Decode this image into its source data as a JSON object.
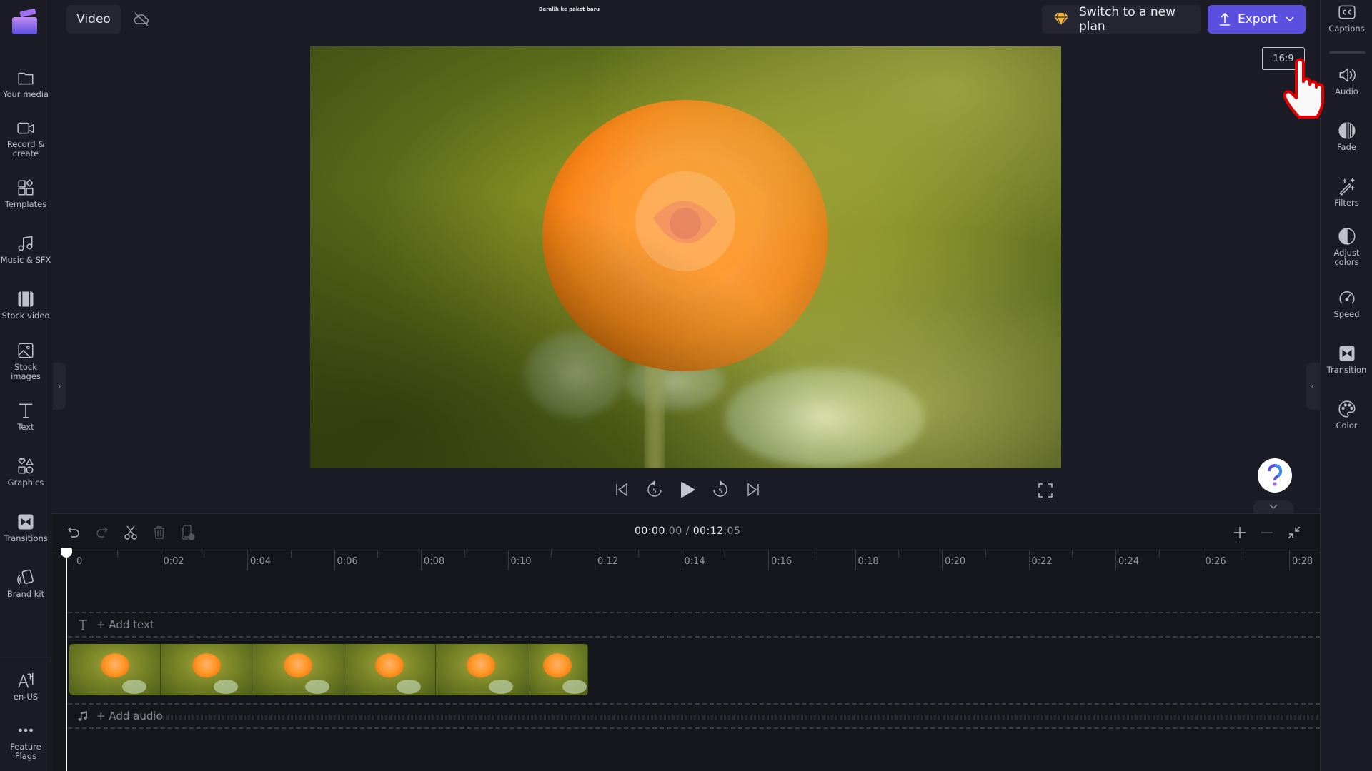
{
  "header": {
    "project_tab": "Video",
    "cloud_status_icon": "cloud-off-icon",
    "center_text": "Beralih ke paket baru",
    "upgrade_button": "Switch to a new plan",
    "export_button": "Export"
  },
  "left_sidebar": {
    "items": [
      {
        "label": "Your media",
        "icon": "folder-icon"
      },
      {
        "label": "Record & create",
        "icon": "video-camera-icon"
      },
      {
        "label": "Templates",
        "icon": "templates-icon"
      },
      {
        "label": "Music & SFX",
        "icon": "music-note-icon"
      },
      {
        "label": "Stock video",
        "icon": "film-strip-icon"
      },
      {
        "label": "Stock images",
        "icon": "image-icon"
      },
      {
        "label": "Text",
        "icon": "text-icon"
      },
      {
        "label": "Graphics",
        "icon": "shapes-icon"
      },
      {
        "label": "Transitions",
        "icon": "transition-icon"
      },
      {
        "label": "Brand kit",
        "icon": "brand-kit-icon"
      }
    ],
    "bottom_items": [
      {
        "label": "en-US",
        "icon": "language-icon"
      },
      {
        "label": "Feature Flags",
        "icon": "more-dots-icon"
      }
    ]
  },
  "right_sidebar": {
    "items": [
      {
        "label": "Captions",
        "icon": "captions-icon"
      },
      {
        "label": "Audio",
        "icon": "speaker-icon"
      },
      {
        "label": "Fade",
        "icon": "fade-icon"
      },
      {
        "label": "Filters",
        "icon": "magic-wand-icon"
      },
      {
        "label": "Adjust colors",
        "icon": "contrast-icon"
      },
      {
        "label": "Speed",
        "icon": "speedometer-icon"
      },
      {
        "label": "Transition",
        "icon": "transition-icon"
      },
      {
        "label": "Color",
        "icon": "palette-icon"
      }
    ]
  },
  "preview": {
    "aspect_ratio": "16:9",
    "subject": "orange rose on blurred green background"
  },
  "player": {
    "controls": [
      "skip-to-start",
      "rewind-5s",
      "play",
      "forward-5s",
      "skip-to-end"
    ],
    "rewind_seconds": "5",
    "forward_seconds": "5"
  },
  "timeline": {
    "current_time_main": "00:00",
    "current_time_frac": ".00",
    "separator": " / ",
    "total_time_main": "00:12",
    "total_time_frac": ".05",
    "ruler_labels": [
      "0",
      "0:02",
      "0:04",
      "0:06",
      "0:08",
      "0:10",
      "0:12",
      "0:14",
      "0:16",
      "0:18",
      "0:20",
      "0:22",
      "0:24",
      "0:26",
      "0:28"
    ],
    "add_text": "+ Add text",
    "add_audio": "+ Add audio",
    "clip_frames": 6,
    "clip_duration_seconds": 12.05
  }
}
